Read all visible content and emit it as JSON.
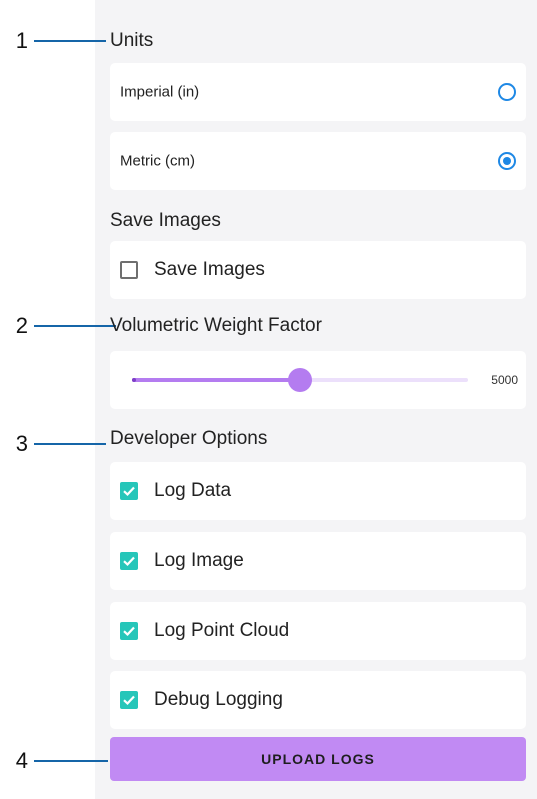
{
  "callouts": [
    "1",
    "2",
    "3",
    "4"
  ],
  "units": {
    "title": "Units",
    "options": [
      {
        "label": "Imperial (in)",
        "selected": false
      },
      {
        "label": "Metric (cm)",
        "selected": true
      }
    ]
  },
  "save_images": {
    "title": "Save Images",
    "checkbox_label": "Save Images",
    "checked": false
  },
  "volumetric": {
    "title": "Volumetric Weight Factor",
    "value": "5000",
    "slider_fraction": 0.5
  },
  "developer": {
    "title": "Developer Options",
    "items": [
      {
        "label": "Log Data",
        "checked": true
      },
      {
        "label": "Log Image",
        "checked": true
      },
      {
        "label": "Log Point Cloud",
        "checked": true
      },
      {
        "label": "Debug Logging",
        "checked": true
      }
    ]
  },
  "upload_button": "UPLOAD LOGS",
  "colors": {
    "accent": "#c18af3",
    "radio": "#1e88e5",
    "checkbox": "#26c6b9",
    "callout_line": "#1565a8"
  }
}
